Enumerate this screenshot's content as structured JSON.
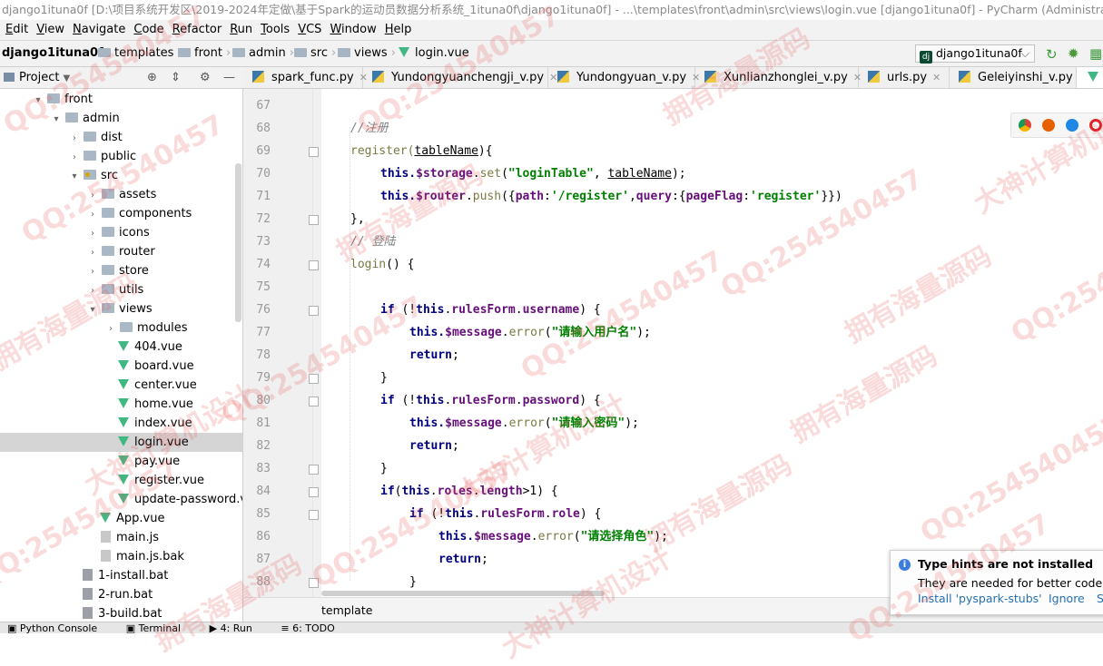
{
  "window": {
    "title": "django1ituna0f [D:\\项目系统开发区\\2019-2024年定做\\基于Spark的运动员数据分析系统_1ituna0f\\django1ituna0f] - ...\\templates\\front\\admin\\src\\views\\login.vue [django1ituna0f] - PyCharm (Administrator)"
  },
  "menu": [
    "Edit",
    "View",
    "Navigate",
    "Code",
    "Refactor",
    "Run",
    "Tools",
    "VCS",
    "Window",
    "Help"
  ],
  "breadcrumbs": [
    "django1ituna0f",
    "templates",
    "front",
    "admin",
    "src",
    "views",
    "login.vue"
  ],
  "run_config": "django1ituna0f",
  "project_panel": {
    "title": "Project"
  },
  "tree": [
    {
      "label": "front",
      "type": "folder",
      "depth": 2,
      "arrow": "▾"
    },
    {
      "label": "admin",
      "type": "folder",
      "depth": 3,
      "arrow": "▾"
    },
    {
      "label": "dist",
      "type": "folder",
      "depth": 4,
      "arrow": "›"
    },
    {
      "label": "public",
      "type": "folder",
      "depth": 4,
      "arrow": "›"
    },
    {
      "label": "src",
      "type": "folder-dot",
      "depth": 4,
      "arrow": "▾"
    },
    {
      "label": "assets",
      "type": "folder",
      "depth": 5,
      "arrow": "›"
    },
    {
      "label": "components",
      "type": "folder",
      "depth": 5,
      "arrow": "›"
    },
    {
      "label": "icons",
      "type": "folder",
      "depth": 5,
      "arrow": "›"
    },
    {
      "label": "router",
      "type": "folder",
      "depth": 5,
      "arrow": "›"
    },
    {
      "label": "store",
      "type": "folder",
      "depth": 5,
      "arrow": "›"
    },
    {
      "label": "utils",
      "type": "folder",
      "depth": 5,
      "arrow": "›"
    },
    {
      "label": "views",
      "type": "folder",
      "depth": 5,
      "arrow": "▾"
    },
    {
      "label": "modules",
      "type": "folder",
      "depth": 6,
      "arrow": "›"
    },
    {
      "label": "404.vue",
      "type": "vue",
      "depth": 6,
      "arrow": ""
    },
    {
      "label": "board.vue",
      "type": "vue",
      "depth": 6,
      "arrow": ""
    },
    {
      "label": "center.vue",
      "type": "vue",
      "depth": 6,
      "arrow": ""
    },
    {
      "label": "home.vue",
      "type": "vue",
      "depth": 6,
      "arrow": ""
    },
    {
      "label": "index.vue",
      "type": "vue",
      "depth": 6,
      "arrow": ""
    },
    {
      "label": "login.vue",
      "type": "vue",
      "depth": 6,
      "arrow": "",
      "selected": true
    },
    {
      "label": "pay.vue",
      "type": "vue",
      "depth": 6,
      "arrow": ""
    },
    {
      "label": "register.vue",
      "type": "vue",
      "depth": 6,
      "arrow": ""
    },
    {
      "label": "update-password.vu",
      "type": "vue",
      "depth": 6,
      "arrow": ""
    },
    {
      "label": "App.vue",
      "type": "vue",
      "depth": 5,
      "arrow": ""
    },
    {
      "label": "main.js",
      "type": "js",
      "depth": 5,
      "arrow": ""
    },
    {
      "label": "main.js.bak",
      "type": "js",
      "depth": 5,
      "arrow": ""
    },
    {
      "label": "1-install.bat",
      "type": "bat",
      "depth": 4,
      "arrow": ""
    },
    {
      "label": "2-run.bat",
      "type": "bat",
      "depth": 4,
      "arrow": ""
    },
    {
      "label": "3-build.bat",
      "type": "bat",
      "depth": 4,
      "arrow": ""
    }
  ],
  "tabs": [
    "spark_func.py",
    "Yundongyuanchengji_v.py",
    "Yundongyuan_v.py",
    "Xunlianzhonglei_v.py",
    "urls.py",
    "Geleiyinshi_v.py"
  ],
  "line_numbers": [
    "67",
    "68",
    "69",
    "70",
    "71",
    "72",
    "73",
    "74",
    "75",
    "76",
    "77",
    "78",
    "79",
    "80",
    "81",
    "82",
    "83",
    "84",
    "85",
    "86",
    "87",
    "88"
  ],
  "code": {
    "c68": "//注册",
    "c69a": "register(",
    "c69b": "tableName",
    "c69c": "){",
    "c70a": "this.",
    "c70b": "$storage",
    "c70c": ".",
    "c70d": "set",
    "c70e": "(",
    "c70f": "\"loginTable\"",
    "c70g": ", ",
    "c70h": "tableName",
    "c70i": ");",
    "c71a": "this.",
    "c71b": "$router",
    "c71c": ".",
    "c71d": "push",
    "c71e": "({",
    "c71f": "path",
    "c71g": ":",
    "c71h": "'/register'",
    "c71i": ",",
    "c71j": "query",
    "c71k": ":{",
    "c71l": "pageFlag",
    "c71m": ":",
    "c71n": "'register'",
    "c71o": "}})",
    "c72": "},",
    "c73": "// 登陆",
    "c74a": "login",
    "c74b": "() {",
    "c76a": "if",
    "c76b": " (!",
    "c76c": "this",
    "c76d": ".",
    "c76e": "rulesForm",
    "c76f": ".",
    "c76g": "username",
    "c76h": ") {",
    "c77a": "this.",
    "c77b": "$message",
    "c77c": ".",
    "c77d": "error",
    "c77e": "(",
    "c77f": "\"请输入用户名\"",
    "c77g": ");",
    "c78": "return",
    "c79": "}",
    "c80a": "if",
    "c80b": " (!",
    "c80c": "this",
    "c80d": ".",
    "c80e": "rulesForm",
    "c80f": ".",
    "c80g": "password",
    "c80h": ") {",
    "c81a": "this.",
    "c81b": "$message",
    "c81c": ".",
    "c81d": "error",
    "c81e": "(",
    "c81f": "\"请输入密码\"",
    "c81g": ");",
    "c82": "return",
    "c83": "}",
    "c84a": "if",
    "c84b": "(",
    "c84c": "this",
    "c84d": ".",
    "c84e": "roles",
    "c84f": ".",
    "c84g": "length",
    "c84h": ">1) {",
    "c85a": "if",
    "c85b": " (!",
    "c85c": "this",
    "c85d": ".",
    "c85e": "rulesForm",
    "c85f": ".",
    "c85g": "role",
    "c85h": ") {",
    "c86a": "this.",
    "c86b": "$message",
    "c86c": ".",
    "c86d": "error",
    "c86e": "(",
    "c86f": "\"请选择角色\"",
    "c86g": ");",
    "c87": "return",
    "c88": "}"
  },
  "editor_breadcrumb": "template",
  "notification": {
    "title": "Type hints are not installed",
    "body": "They are needed for better code in",
    "action1": "Install 'pyspark-stubs'",
    "action2": "Ignore",
    "action3": "S"
  },
  "bottom_tools": [
    "Python Console",
    "Terminal",
    "4: Run",
    "6: TODO"
  ],
  "watermarks": [
    "QQ:254540457",
    "拥有海量源码",
    "大神计算机设计"
  ]
}
